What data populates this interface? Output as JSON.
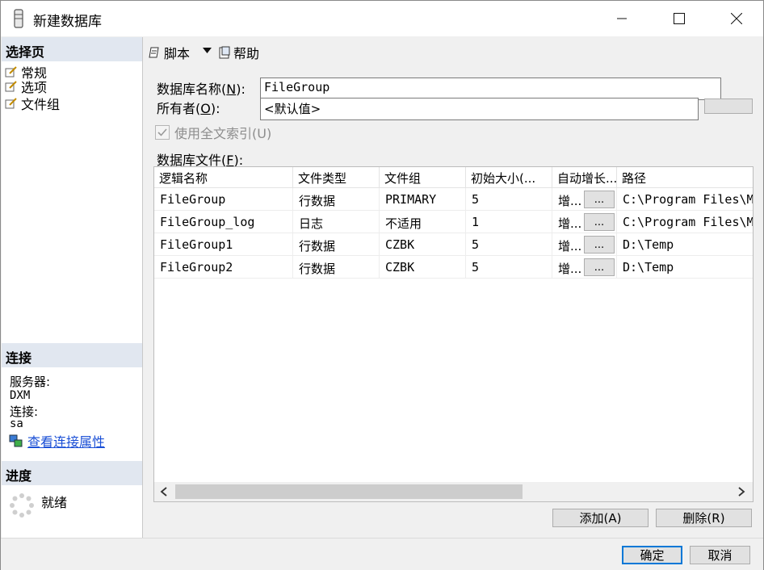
{
  "window": {
    "title": "新建数据库",
    "icons": {
      "app": "database-icon",
      "minimize": "minimize-icon",
      "maximize": "maximize-icon",
      "close": "close-icon"
    }
  },
  "left": {
    "select_page_header": "选择页",
    "nav_items": [
      {
        "label": "常规",
        "icon": "page-icon"
      },
      {
        "label": "选项",
        "icon": "page-icon"
      },
      {
        "label": "文件组",
        "icon": "page-icon"
      }
    ],
    "connection_header": "连接",
    "server_label": "服务器:",
    "server_value": "DXM",
    "connection_label": "连接:",
    "connection_value": "sa",
    "view_props_link": "查看连接属性",
    "progress_header": "进度",
    "progress_status": "就绪"
  },
  "toolbar": {
    "script_label": "脚本",
    "help_label": "帮助"
  },
  "form": {
    "db_name_label": "数据库名称",
    "db_name_hotkey": "N",
    "db_name_value": "FileGroup",
    "owner_label": "所有者",
    "owner_hotkey": "O",
    "owner_value": "<默认值>",
    "fulltext_label": "使用全文索引(U)",
    "fulltext_checked": true,
    "files_label": "数据库文件",
    "files_hotkey": "F"
  },
  "grid": {
    "columns": [
      "逻辑名称",
      "文件类型",
      "文件组",
      "初始大小(...",
      "自动增长...",
      "路径"
    ],
    "rows": [
      [
        "FileGroup",
        "行数据",
        "PRIMARY",
        "5",
        "增...",
        "C:\\Program Files\\M"
      ],
      [
        "FileGroup_log",
        "日志",
        "不适用",
        "1",
        "增...",
        "C:\\Program Files\\M"
      ],
      [
        "FileGroup1",
        "行数据",
        "CZBK",
        "5",
        "增...",
        "D:\\Temp"
      ],
      [
        "FileGroup2",
        "行数据",
        "CZBK",
        "5",
        "增...",
        "D:\\Temp"
      ]
    ],
    "ellipsis": "...",
    "add_button": "添加(A)",
    "remove_button": "删除(R)"
  },
  "footer": {
    "ok_button": "确定",
    "cancel_button": "取消"
  }
}
